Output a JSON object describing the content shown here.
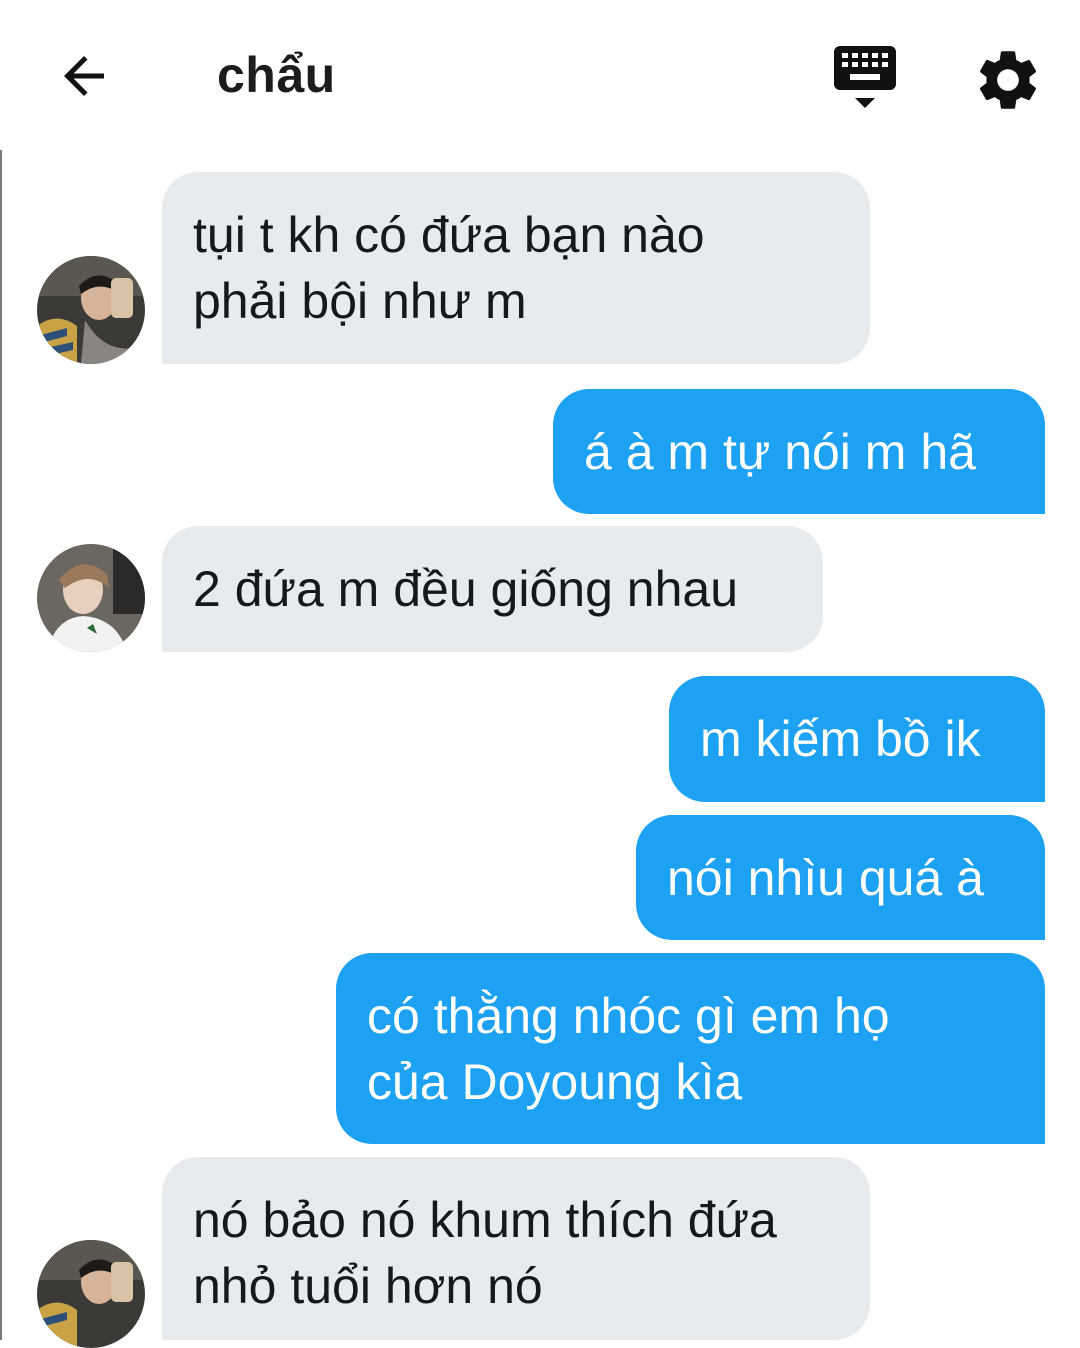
{
  "header": {
    "title": "chẩu",
    "back_icon": "arrow-left-icon",
    "keyboard_icon": "keyboard-icon",
    "settings_icon": "gear-icon"
  },
  "messages": [
    {
      "from": "them",
      "text": "tụi t kh có đứa bạn nào\nphải bội như m"
    },
    {
      "from": "me",
      "text": "á à m tự nói m hã"
    },
    {
      "from": "them",
      "text": "2 đứa m đều giống nhau"
    },
    {
      "from": "me",
      "text": "m kiếm bồ ik"
    },
    {
      "from": "me",
      "text": "nói nhìu quá à"
    },
    {
      "from": "me",
      "text": "có thằng nhóc gì em họ\ncủa Doyoung kìa"
    },
    {
      "from": "them",
      "text": "nó bảo nó khum thích đứa\nnhỏ tuổi hơn nó"
    }
  ],
  "colors": {
    "incoming_bubble": "#e8ebee",
    "outgoing_bubble": "#1da1f2",
    "text_dark": "#15191d"
  }
}
